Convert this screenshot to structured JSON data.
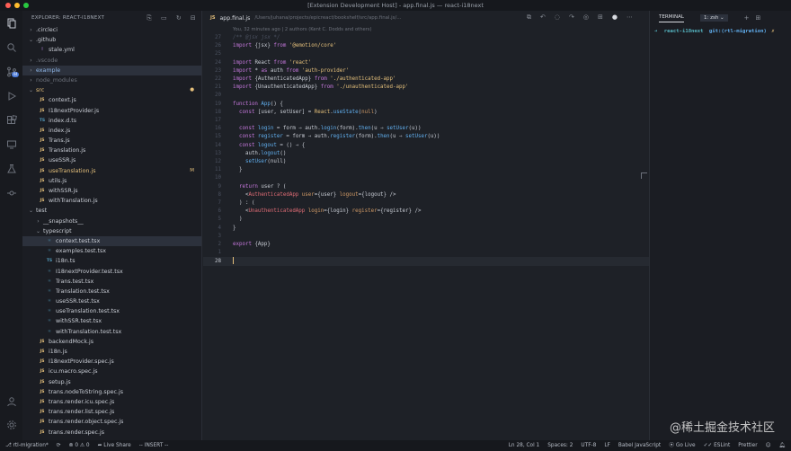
{
  "window": {
    "title": "[Extension Development Host] - app.final.js — react-i18next"
  },
  "activity_bar": {
    "icons": [
      "files-icon",
      "search-icon",
      "source-control-icon",
      "run-debug-icon",
      "extensions-icon",
      "remote-icon",
      "testing-icon",
      "git-graph-icon"
    ],
    "badge": "44",
    "bottom_icons": [
      "account-icon",
      "settings-gear-icon"
    ]
  },
  "sidebar": {
    "header": "EXPLORER: REACT-I18NEXT",
    "items": [
      {
        "label": ".circleci",
        "type": "folder",
        "open": false,
        "depth": 0
      },
      {
        "label": ".github",
        "type": "folder",
        "open": true,
        "depth": 0
      },
      {
        "label": "stale.yml",
        "type": "yml",
        "depth": 1
      },
      {
        "label": ".vscode",
        "type": "folder",
        "open": false,
        "depth": 0,
        "muted": true
      },
      {
        "label": "example",
        "type": "folder",
        "open": false,
        "depth": 0,
        "selected": true,
        "color": "#8fb7e8"
      },
      {
        "label": "node_modules",
        "type": "folder",
        "open": false,
        "depth": 0,
        "muted": true
      },
      {
        "label": "src",
        "type": "folder",
        "open": true,
        "depth": 0,
        "color": "#e5c07b",
        "badge": "●"
      },
      {
        "label": "context.js",
        "type": "js",
        "depth": 1
      },
      {
        "label": "I18nextProvider.js",
        "type": "js",
        "depth": 1
      },
      {
        "label": "index.d.ts",
        "type": "ts",
        "depth": 1
      },
      {
        "label": "index.js",
        "type": "js",
        "depth": 1
      },
      {
        "label": "Trans.js",
        "type": "js",
        "depth": 1
      },
      {
        "label": "Translation.js",
        "type": "js",
        "depth": 1
      },
      {
        "label": "useSSR.js",
        "type": "js",
        "depth": 1
      },
      {
        "label": "useTranslation.js",
        "type": "js",
        "depth": 1,
        "color": "#e5c07b",
        "badge": "M"
      },
      {
        "label": "utils.js",
        "type": "js",
        "depth": 1
      },
      {
        "label": "withSSR.js",
        "type": "js",
        "depth": 1
      },
      {
        "label": "withTranslation.js",
        "type": "js",
        "depth": 1
      },
      {
        "label": "test",
        "type": "folder",
        "open": true,
        "depth": 0
      },
      {
        "label": "__snapshots__",
        "type": "folder",
        "open": false,
        "depth": 1
      },
      {
        "label": "typescript",
        "type": "folder",
        "open": true,
        "depth": 1
      },
      {
        "label": "context.test.tsx",
        "type": "tsx",
        "depth": 2,
        "selected": true
      },
      {
        "label": "examples.test.tsx",
        "type": "tsx",
        "depth": 2
      },
      {
        "label": "i18n.ts",
        "type": "ts",
        "depth": 2
      },
      {
        "label": "I18nextProvider.test.tsx",
        "type": "tsx",
        "depth": 2
      },
      {
        "label": "Trans.test.tsx",
        "type": "tsx",
        "depth": 2
      },
      {
        "label": "Translation.test.tsx",
        "type": "tsx",
        "depth": 2
      },
      {
        "label": "useSSR.test.tsx",
        "type": "tsx",
        "depth": 2
      },
      {
        "label": "useTranslation.test.tsx",
        "type": "tsx",
        "depth": 2
      },
      {
        "label": "withSSR.test.tsx",
        "type": "tsx",
        "depth": 2
      },
      {
        "label": "withTranslation.test.tsx",
        "type": "tsx",
        "depth": 2
      },
      {
        "label": "backendMock.js",
        "type": "js",
        "depth": 1
      },
      {
        "label": "i18n.js",
        "type": "js",
        "depth": 1
      },
      {
        "label": "I18nextProvider.spec.js",
        "type": "js",
        "depth": 1
      },
      {
        "label": "icu.macro.spec.js",
        "type": "js",
        "depth": 1
      },
      {
        "label": "setup.js",
        "type": "js",
        "depth": 1
      },
      {
        "label": "trans.nodeToString.spec.js",
        "type": "js",
        "depth": 1
      },
      {
        "label": "trans.render.icu.spec.js",
        "type": "js",
        "depth": 1
      },
      {
        "label": "trans.render.list.spec.js",
        "type": "js",
        "depth": 1
      },
      {
        "label": "trans.render.object.spec.js",
        "type": "js",
        "depth": 1
      },
      {
        "label": "trans.render.spec.js",
        "type": "js",
        "depth": 1
      }
    ]
  },
  "editor": {
    "tab": {
      "icon": "JS",
      "name": "app.final.js",
      "path": "/Users/juhana/projects/epicreact/bookshelf/src/app.final.js/..."
    },
    "blame": "You, 32 minutes ago | 2 authors (Kent C. Dodds and others)",
    "lines": [
      {
        "n": "27",
        "tokens": [
          [
            "/** @jsx jsx */",
            "#4b5160"
          ]
        ]
      },
      {
        "n": "26",
        "tokens": [
          [
            "import",
            "#c678dd"
          ],
          [
            " {jsx} ",
            "#c8ccd4"
          ],
          [
            "from",
            "#c678dd"
          ],
          [
            " '@emotion/core'",
            "#e5c07b"
          ]
        ]
      },
      {
        "n": "25",
        "tokens": []
      },
      {
        "n": "24",
        "tokens": [
          [
            "import",
            "#c678dd"
          ],
          [
            " React ",
            "#c8ccd4"
          ],
          [
            "from",
            "#c678dd"
          ],
          [
            " 'react'",
            "#e5c07b"
          ]
        ]
      },
      {
        "n": "23",
        "tokens": [
          [
            "import",
            "#c678dd"
          ],
          [
            " * ",
            "#c8ccd4"
          ],
          [
            "as",
            "#c678dd"
          ],
          [
            " auth ",
            "#c8ccd4"
          ],
          [
            "from",
            "#c678dd"
          ],
          [
            " 'auth-provider'",
            "#e5c07b"
          ]
        ]
      },
      {
        "n": "22",
        "tokens": [
          [
            "import",
            "#c678dd"
          ],
          [
            " {AuthenticatedApp} ",
            "#c8ccd4"
          ],
          [
            "from",
            "#c678dd"
          ],
          [
            " './authenticated-app'",
            "#e5c07b"
          ]
        ]
      },
      {
        "n": "21",
        "tokens": [
          [
            "import",
            "#c678dd"
          ],
          [
            " {UnauthenticatedApp} ",
            "#c8ccd4"
          ],
          [
            "from",
            "#c678dd"
          ],
          [
            " './unauthenticated-app'",
            "#e5c07b"
          ]
        ]
      },
      {
        "n": "20",
        "tokens": []
      },
      {
        "n": "19",
        "tokens": [
          [
            "function",
            "#c678dd"
          ],
          [
            " App",
            "#61afef"
          ],
          [
            "() {",
            "#c8ccd4"
          ]
        ]
      },
      {
        "n": "18",
        "tokens": [
          [
            "  ",
            "#c8ccd4"
          ],
          [
            "const",
            "#c678dd"
          ],
          [
            " [user, setUser] = ",
            "#c8ccd4"
          ],
          [
            "React",
            "#e5c07b"
          ],
          [
            ".",
            "#c8ccd4"
          ],
          [
            "useState",
            "#61afef"
          ],
          [
            "(",
            "#c8ccd4"
          ],
          [
            "null",
            "#d19a66"
          ],
          [
            ")",
            "#c8ccd4"
          ]
        ]
      },
      {
        "n": "17",
        "tokens": []
      },
      {
        "n": "16",
        "tokens": [
          [
            "  ",
            "#c8ccd4"
          ],
          [
            "const",
            "#c678dd"
          ],
          [
            " login",
            "#61afef"
          ],
          [
            " = form ⇒ auth.",
            "#c8ccd4"
          ],
          [
            "login",
            "#61afef"
          ],
          [
            "(form).",
            "#c8ccd4"
          ],
          [
            "then",
            "#61afef"
          ],
          [
            "(u ⇒ ",
            "#c8ccd4"
          ],
          [
            "setUser",
            "#61afef"
          ],
          [
            "(u))",
            "#c8ccd4"
          ]
        ]
      },
      {
        "n": "15",
        "tokens": [
          [
            "  ",
            "#c8ccd4"
          ],
          [
            "const",
            "#c678dd"
          ],
          [
            " register",
            "#61afef"
          ],
          [
            " = form ⇒ auth.",
            "#c8ccd4"
          ],
          [
            "register",
            "#61afef"
          ],
          [
            "(form).",
            "#c8ccd4"
          ],
          [
            "then",
            "#61afef"
          ],
          [
            "(u ⇒ ",
            "#c8ccd4"
          ],
          [
            "setUser",
            "#61afef"
          ],
          [
            "(u))",
            "#c8ccd4"
          ]
        ]
      },
      {
        "n": "14",
        "tokens": [
          [
            "  ",
            "#c8ccd4"
          ],
          [
            "const",
            "#c678dd"
          ],
          [
            " logout",
            "#61afef"
          ],
          [
            " = () ⇒ {",
            "#c8ccd4"
          ]
        ]
      },
      {
        "n": "13",
        "tokens": [
          [
            "    auth.",
            "#c8ccd4"
          ],
          [
            "logout",
            "#61afef"
          ],
          [
            "()",
            "#c8ccd4"
          ]
        ]
      },
      {
        "n": "12",
        "tokens": [
          [
            "    ",
            "#c8ccd4"
          ],
          [
            "setUser",
            "#61afef"
          ],
          [
            "(null)",
            "#c8ccd4"
          ]
        ]
      },
      {
        "n": "11",
        "tokens": [
          [
            "  }",
            "#c8ccd4"
          ]
        ]
      },
      {
        "n": "10",
        "tokens": []
      },
      {
        "n": "9",
        "tokens": [
          [
            "  ",
            "#c8ccd4"
          ],
          [
            "return",
            "#c678dd"
          ],
          [
            " user ? (",
            "#c8ccd4"
          ]
        ]
      },
      {
        "n": "8",
        "tokens": [
          [
            "    <",
            "#c8ccd4"
          ],
          [
            "AuthenticatedApp",
            "#e06c75"
          ],
          [
            " user",
            "#d19a66"
          ],
          [
            "={user} ",
            "#c8ccd4"
          ],
          [
            "logout",
            "#d19a66"
          ],
          [
            "={logout} />",
            "#c8ccd4"
          ]
        ]
      },
      {
        "n": "7",
        "tokens": [
          [
            "  ) : (",
            "#c8ccd4"
          ]
        ]
      },
      {
        "n": "6",
        "tokens": [
          [
            "    <",
            "#c8ccd4"
          ],
          [
            "UnauthenticatedApp",
            "#e06c75"
          ],
          [
            " login",
            "#d19a66"
          ],
          [
            "={login} ",
            "#c8ccd4"
          ],
          [
            "register",
            "#d19a66"
          ],
          [
            "={register} />",
            "#c8ccd4"
          ]
        ]
      },
      {
        "n": "5",
        "tokens": [
          [
            "  )",
            "#c8ccd4"
          ]
        ]
      },
      {
        "n": "4",
        "tokens": [
          [
            "}",
            "#c8ccd4"
          ]
        ]
      },
      {
        "n": "3",
        "tokens": []
      },
      {
        "n": "2",
        "tokens": [
          [
            "export",
            "#c678dd"
          ],
          [
            " {App}",
            "#c8ccd4"
          ]
        ]
      },
      {
        "n": "1",
        "tokens": []
      },
      {
        "n": "28",
        "tokens": [],
        "current": true
      }
    ]
  },
  "terminal": {
    "tab": "TERMINAL",
    "shell": "1: zsh",
    "prompt_arrow": "➜",
    "dir": "react-i18next",
    "git": "git:(rtl-migration)",
    "mark": "✗"
  },
  "statusbar": {
    "branch": "rtl-migration*",
    "problems": "⊗ 0 ⚠ 0",
    "live_share": "Live Share",
    "mode": "-- INSERT --",
    "position": "Ln 28, Col 1",
    "spaces": "Spaces: 2",
    "encoding": "UTF-8",
    "eol": "LF",
    "language": "Babel JavaScript",
    "golive": "Go Live",
    "eslint": "ESLint",
    "prettier": "Prettier"
  },
  "watermark": "@稀土掘金技术社区",
  "colors": {
    "accent": "#e5c07b",
    "selection": "#2c313c",
    "background": "#1e2127"
  }
}
